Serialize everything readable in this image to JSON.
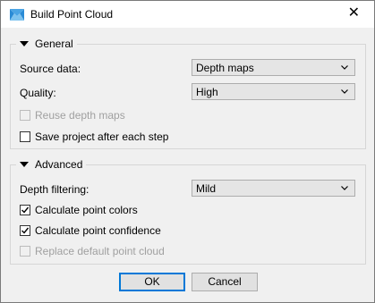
{
  "dialog": {
    "title": "Build Point Cloud",
    "close_glyph": "✕"
  },
  "general": {
    "title": "General",
    "source_data": {
      "label": "Source data:",
      "value": "Depth maps"
    },
    "quality": {
      "label": "Quality:",
      "value": "High"
    },
    "reuse_depth_maps": {
      "label": "Reuse depth maps",
      "checked": false,
      "enabled": false
    },
    "save_project": {
      "label": "Save project after each step",
      "checked": false,
      "enabled": true
    }
  },
  "advanced": {
    "title": "Advanced",
    "depth_filtering": {
      "label": "Depth filtering:",
      "value": "Mild"
    },
    "calc_colors": {
      "label": "Calculate point colors",
      "checked": true,
      "enabled": true
    },
    "calc_confidence": {
      "label": "Calculate point confidence",
      "checked": true,
      "enabled": true
    },
    "replace_default": {
      "label": "Replace default point cloud",
      "checked": false,
      "enabled": false
    }
  },
  "buttons": {
    "ok": "OK",
    "cancel": "Cancel"
  },
  "icons": {
    "app": "metashape-app-icon",
    "close": "close-icon",
    "collapse": "triangle-down-icon",
    "dropdown": "chevron-down-icon",
    "check": "checkmark-icon"
  },
  "colors": {
    "accent": "#0078d7",
    "window_bg": "#f0f0f0",
    "titlebar_bg": "#ffffff"
  }
}
